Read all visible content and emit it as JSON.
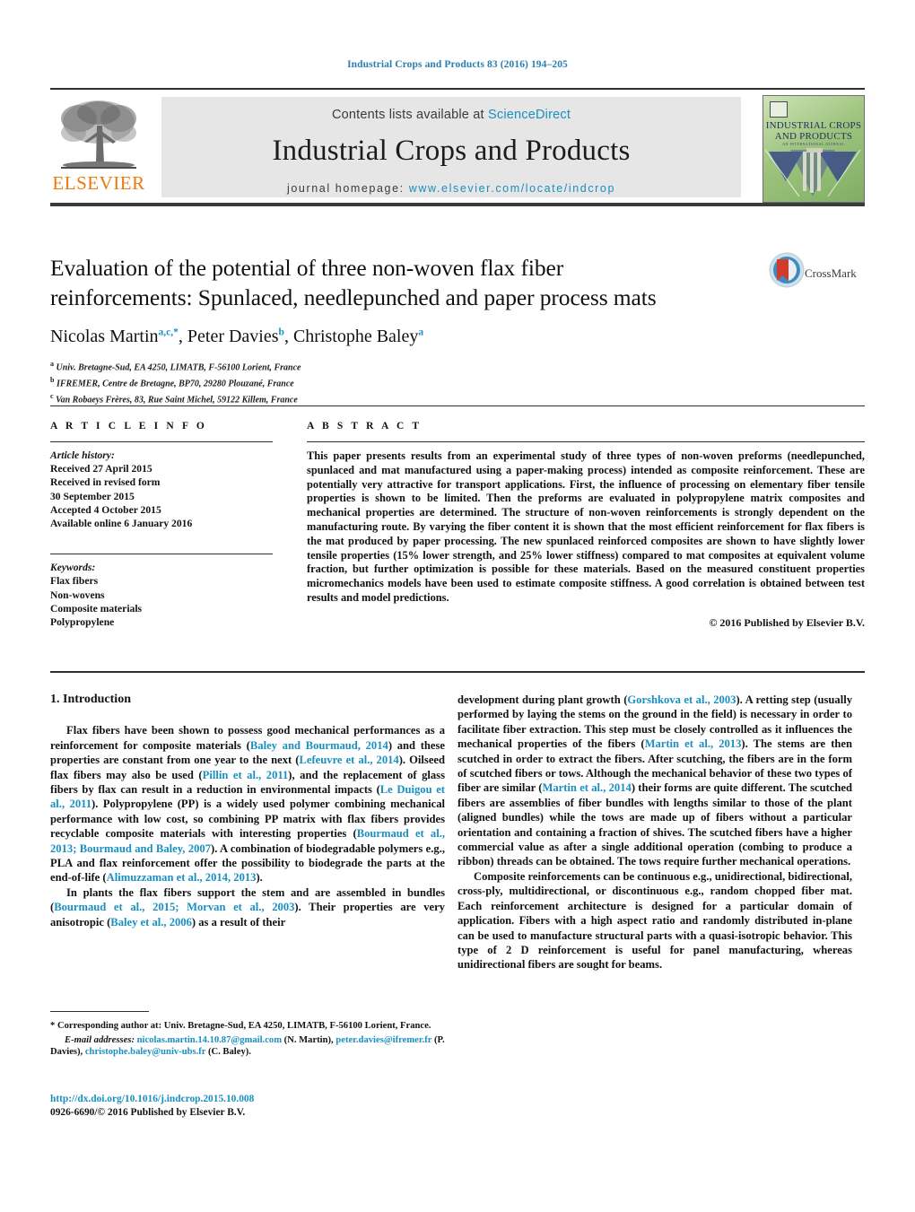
{
  "running_head": "Industrial Crops and Products 83 (2016) 194–205",
  "masthead": {
    "contents_prefix": "Contents lists available at ",
    "contents_link": "ScienceDirect",
    "journal_title": "Industrial Crops and Products",
    "homepage_prefix": "journal homepage: ",
    "homepage_url": "www.elsevier.com/locate/indcrop",
    "publisher_name": "ELSEVIER",
    "cover_title_line1": "INDUSTRIAL CROPS",
    "cover_title_line2": "AND PRODUCTS",
    "cover_subtitle": "AN INTERNATIONAL JOURNAL"
  },
  "crossmark": {
    "label": "CrossMark"
  },
  "article": {
    "title_line1": "Evaluation of the potential of three non-woven flax fiber",
    "title_line2": "reinforcements: Spunlaced, needlepunched and paper process mats",
    "authors_plain": "Nicolas Martin a,c,*, Peter Davies b, Christophe Baley a",
    "authors": [
      {
        "name": "Nicolas Martin",
        "sup": "a,c,*"
      },
      {
        "name": "Peter Davies",
        "sup": "b"
      },
      {
        "name": "Christophe Baley",
        "sup": "a"
      }
    ],
    "affiliations": [
      {
        "marker": "a",
        "text": "Univ. Bretagne-Sud, EA 4250, LIMATB, F-56100 Lorient, France"
      },
      {
        "marker": "b",
        "text": "IFREMER, Centre de Bretagne, BP70, 29280 Plouzané, France"
      },
      {
        "marker": "c",
        "text": "Van Robaeys Frères, 83, Rue Saint Michel, 59122 Killem, France"
      }
    ]
  },
  "article_info": {
    "heading": "A R T I C L E    I N F O",
    "history_label": "Article history:",
    "history": [
      "Received 27 April 2015",
      "Received in revised form",
      "30 September 2015",
      "Accepted 4 October 2015",
      "Available online 6 January 2016"
    ],
    "keywords_label": "Keywords:",
    "keywords": [
      "Flax fibers",
      "Non-wovens",
      "Composite materials",
      "Polypropylene"
    ]
  },
  "abstract": {
    "heading": "A B S T R A C T",
    "text": "This paper presents results from an experimental study of three types of non-woven preforms (needlepunched, spunlaced and mat manufactured using a paper-making process) intended as composite reinforcement. These are potentially very attractive for transport applications. First, the influence of processing on elementary fiber tensile properties is shown to be limited. Then the preforms are evaluated in polypropylene matrix composites and mechanical properties are determined. The structure of non-woven reinforcements is strongly dependent on the manufacturing route. By varying the fiber content it is shown that the most efficient reinforcement for flax fibers is the mat produced by paper processing. The new spunlaced reinforced composites are shown to have slightly lower tensile properties (15% lower strength, and 25% lower stiffness) compared to mat composites at equivalent volume fraction, but further optimization is possible for these materials. Based on the measured constituent properties micromechanics models have been used to estimate composite stiffness. A good correlation is obtained between test results and model predictions.",
    "copyright": "© 2016 Published by Elsevier B.V."
  },
  "body": {
    "section_number_title": "1.  Introduction",
    "left_paragraphs": [
      {
        "runs": [
          {
            "t": "Flax fibers have been shown to possess good mechanical performances as a reinforcement for composite materials ("
          },
          {
            "t": "Baley and Bourmaud, 2014",
            "ref": true
          },
          {
            "t": ") and these properties are constant from one year to the next ("
          },
          {
            "t": "Lefeuvre et al., 2014",
            "ref": true
          },
          {
            "t": "). Oilseed flax fibers may also be used ("
          },
          {
            "t": "Pillin et al., 2011",
            "ref": true
          },
          {
            "t": "), and the replacement of glass fibers by flax can result in a reduction in environmental impacts ("
          },
          {
            "t": "Le Duigou et al., 2011",
            "ref": true
          },
          {
            "t": "). Polypropylene (PP) is a widely used polymer combining mechanical performance with low cost, so combining PP matrix with flax fibers provides recyclable composite materials with interesting properties ("
          },
          {
            "t": "Bourmaud et al., 2013; Bourmaud and Baley, 2007",
            "ref": true
          },
          {
            "t": "). A combination of biodegradable polymers e.g., PLA and flax reinforcement offer the possibility to biodegrade the parts at the end-of-life ("
          },
          {
            "t": "Alimuzzaman et al., 2014, 2013",
            "ref": true
          },
          {
            "t": ")."
          }
        ]
      },
      {
        "runs": [
          {
            "t": "In plants the flax fibers support the stem and are assembled in bundles ("
          },
          {
            "t": "Bourmaud et al., 2015; Morvan et al., 2003",
            "ref": true
          },
          {
            "t": "). Their properties are very anisotropic ("
          },
          {
            "t": "Baley et al., 2006",
            "ref": true
          },
          {
            "t": ") as a result of their"
          }
        ]
      }
    ],
    "right_paragraphs": [
      {
        "runs": [
          {
            "t": "development during plant growth ("
          },
          {
            "t": "Gorshkova et al., 2003",
            "ref": true
          },
          {
            "t": "). A retting step (usually performed by laying the stems on the ground in the field) is necessary in order to facilitate fiber extraction. This step must be closely controlled as it influences the mechanical properties of the fibers ("
          },
          {
            "t": "Martin et al., 2013",
            "ref": true
          },
          {
            "t": "). The stems are then scutched in order to extract the fibers. After scutching, the fibers are in the form of scutched fibers or tows. Although the mechanical behavior of these two types of fiber are similar ("
          },
          {
            "t": "Martin et al., 2014",
            "ref": true
          },
          {
            "t": ") their forms are quite different. The scutched fibers are assemblies of fiber bundles with lengths similar to those of the plant (aligned bundles) while the tows are made up of fibers without a particular orientation and containing a fraction of shives. The scutched fibers have a higher commercial value as after a single additional operation (combing to produce a ribbon) threads can be obtained. The tows require further mechanical operations."
          }
        ]
      },
      {
        "runs": [
          {
            "t": "Composite reinforcements can be continuous e.g., unidirectional, bidirectional, cross-ply, multidirectional, or discontinuous e.g., random chopped fiber mat. Each reinforcement architecture is designed for a particular domain of application. Fibers with a high aspect ratio and randomly distributed in-plane can be used to manufacture structural parts with a quasi-isotropic behavior. This type of 2 D reinforcement is useful for panel manufacturing, whereas unidirectional fibers are sought for beams."
          }
        ]
      }
    ]
  },
  "footnotes": {
    "corresponding": "* Corresponding author at: Univ. Bretagne-Sud, EA 4250, LIMATB, F-56100 Lorient, France.",
    "email_label": "E-mail addresses:",
    "emails": [
      {
        "address": "nicolas.martin.14.10.87@gmail.com",
        "person": " (N. Martin),"
      },
      {
        "address": "peter.davies@ifremer.fr",
        "person": " (P. Davies),"
      },
      {
        "address": "christophe.baley@univ-ubs.fr",
        "person": " (C. Baley)."
      }
    ],
    "doi": "http://dx.doi.org/10.1016/j.indcrop.2015.10.008",
    "issn_line": "0926-6690/© 2016 Published by Elsevier B.V."
  },
  "colors": {
    "link_blue": "#1a8fc1",
    "elsevier_orange": "#ec7a08",
    "rule_dark": "#2e2e2e"
  }
}
